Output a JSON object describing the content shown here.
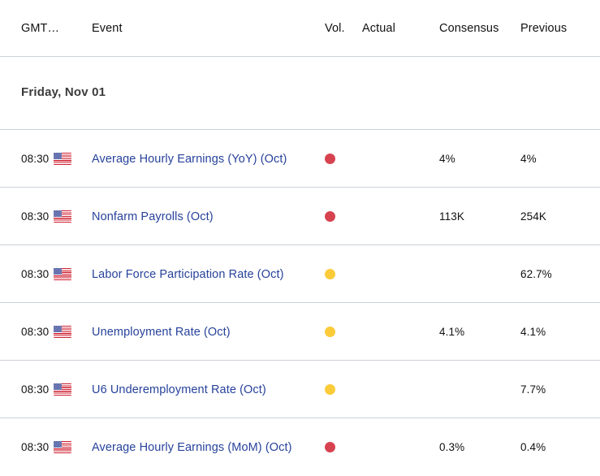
{
  "table": {
    "columns": {
      "time": "GMT…",
      "event": "Event",
      "vol": "Vol.",
      "actual": "Actual",
      "consensus": "Consensus",
      "previous": "Previous"
    },
    "date_group": "Friday, Nov 01",
    "rows": [
      {
        "time": "08:30",
        "country_icon": "us-flag-icon",
        "event": "Average Hourly Earnings (YoY) (Oct)",
        "volatility": "high",
        "actual": "",
        "consensus": "4%",
        "previous": "4%"
      },
      {
        "time": "08:30",
        "country_icon": "us-flag-icon",
        "event": "Nonfarm Payrolls (Oct)",
        "volatility": "high",
        "actual": "",
        "consensus": "113K",
        "previous": "254K"
      },
      {
        "time": "08:30",
        "country_icon": "us-flag-icon",
        "event": "Labor Force Participation Rate (Oct)",
        "volatility": "medium",
        "actual": "",
        "consensus": "",
        "previous": "62.7%"
      },
      {
        "time": "08:30",
        "country_icon": "us-flag-icon",
        "event": "Unemployment Rate (Oct)",
        "volatility": "medium",
        "actual": "",
        "consensus": "4.1%",
        "previous": "4.1%"
      },
      {
        "time": "08:30",
        "country_icon": "us-flag-icon",
        "event": "U6 Underemployment Rate (Oct)",
        "volatility": "medium",
        "actual": "",
        "consensus": "",
        "previous": "7.7%"
      },
      {
        "time": "08:30",
        "country_icon": "us-flag-icon",
        "event": "Average Hourly Earnings (MoM) (Oct)",
        "volatility": "high",
        "actual": "",
        "consensus": "0.3%",
        "previous": "0.4%"
      }
    ]
  },
  "colors": {
    "volatility_high": "#d6434f",
    "volatility_medium": "#fbcb3a",
    "event_link": "#27429b",
    "divider": "#ccd2d8",
    "date_label": "#3b3b3b"
  }
}
